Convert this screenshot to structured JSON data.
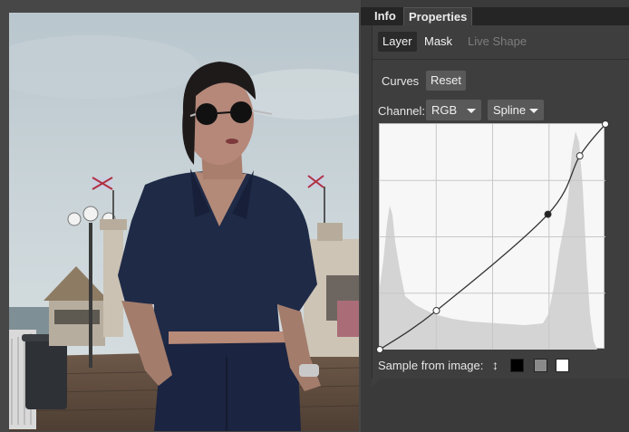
{
  "tabs": {
    "info": "Info",
    "properties": "Properties"
  },
  "subtabs": {
    "layer": "Layer",
    "mask": "Mask",
    "live_shape": "Live Shape"
  },
  "curves": {
    "label": "Curves",
    "reset_label": "Reset",
    "channel_label": "Channel:",
    "channel_value": "RGB",
    "mode_value": "Spline"
  },
  "sample": {
    "label": "Sample from image:",
    "cursor_glyph": "↕",
    "swatches": [
      "#000000",
      "#8a8a8a",
      "#ffffff"
    ]
  },
  "curve_points": [
    {
      "input": 0,
      "output": 0
    },
    {
      "input": 64,
      "output": 44
    },
    {
      "input": 190,
      "output": 153
    },
    {
      "input": 226,
      "output": 219
    },
    {
      "input": 255,
      "output": 255
    }
  ],
  "colors": {
    "panel_bg": "#3e3e3e",
    "tab_bar_bg": "#252525",
    "button_bg": "#595959",
    "curve_line": "#333333",
    "histogram_fill": "#d4d4d4"
  }
}
